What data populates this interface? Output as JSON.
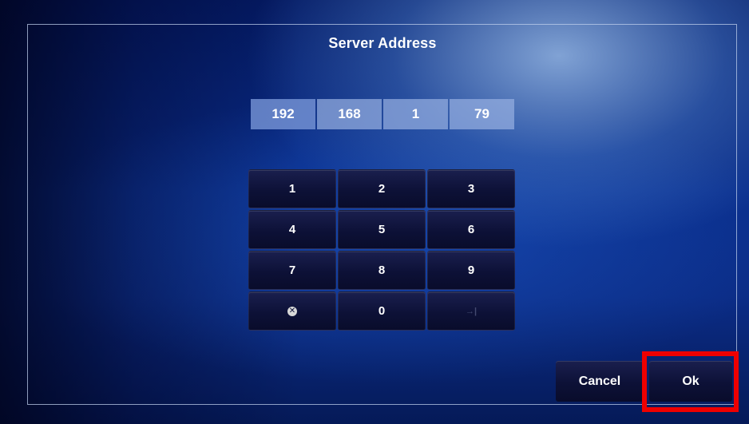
{
  "dialog": {
    "title": "Server Address"
  },
  "ip_address": {
    "octets": [
      "192",
      "168",
      "1",
      "79"
    ]
  },
  "keypad": {
    "keys": [
      "1",
      "2",
      "3",
      "4",
      "5",
      "6",
      "7",
      "8",
      "9",
      "",
      "0",
      ""
    ],
    "clear_icon": "x-circle-icon",
    "tab_icon": "tab-arrow-icon"
  },
  "actions": {
    "cancel_label": "Cancel",
    "ok_label": "Ok"
  },
  "colors": {
    "highlight": "#ee0000",
    "key_background": "#0d1137",
    "octet_background": "#96afe1"
  }
}
